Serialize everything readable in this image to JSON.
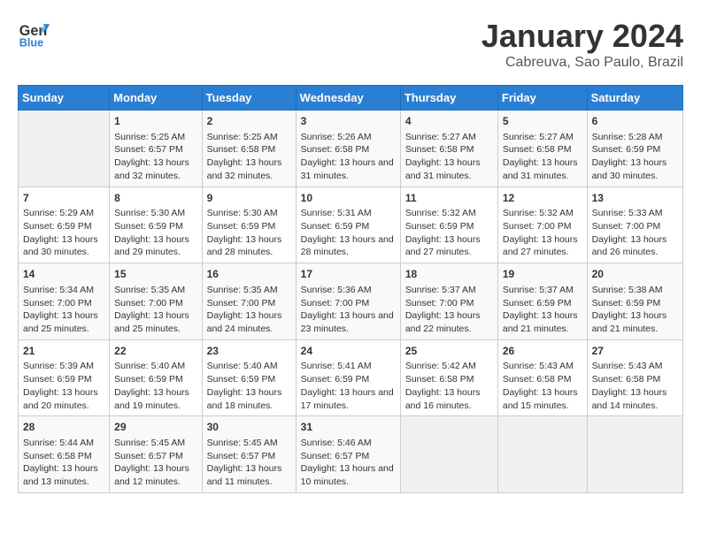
{
  "header": {
    "logo_line1": "General",
    "logo_line2": "Blue",
    "month_title": "January 2024",
    "location": "Cabreuva, Sao Paulo, Brazil"
  },
  "days_of_week": [
    "Sunday",
    "Monday",
    "Tuesday",
    "Wednesday",
    "Thursday",
    "Friday",
    "Saturday"
  ],
  "weeks": [
    [
      {
        "day": "",
        "empty": true
      },
      {
        "day": "1",
        "sunrise": "Sunrise: 5:25 AM",
        "sunset": "Sunset: 6:57 PM",
        "daylight": "Daylight: 13 hours and 32 minutes."
      },
      {
        "day": "2",
        "sunrise": "Sunrise: 5:25 AM",
        "sunset": "Sunset: 6:58 PM",
        "daylight": "Daylight: 13 hours and 32 minutes."
      },
      {
        "day": "3",
        "sunrise": "Sunrise: 5:26 AM",
        "sunset": "Sunset: 6:58 PM",
        "daylight": "Daylight: 13 hours and 31 minutes."
      },
      {
        "day": "4",
        "sunrise": "Sunrise: 5:27 AM",
        "sunset": "Sunset: 6:58 PM",
        "daylight": "Daylight: 13 hours and 31 minutes."
      },
      {
        "day": "5",
        "sunrise": "Sunrise: 5:27 AM",
        "sunset": "Sunset: 6:58 PM",
        "daylight": "Daylight: 13 hours and 31 minutes."
      },
      {
        "day": "6",
        "sunrise": "Sunrise: 5:28 AM",
        "sunset": "Sunset: 6:59 PM",
        "daylight": "Daylight: 13 hours and 30 minutes."
      }
    ],
    [
      {
        "day": "7",
        "sunrise": "Sunrise: 5:29 AM",
        "sunset": "Sunset: 6:59 PM",
        "daylight": "Daylight: 13 hours and 30 minutes."
      },
      {
        "day": "8",
        "sunrise": "Sunrise: 5:30 AM",
        "sunset": "Sunset: 6:59 PM",
        "daylight": "Daylight: 13 hours and 29 minutes."
      },
      {
        "day": "9",
        "sunrise": "Sunrise: 5:30 AM",
        "sunset": "Sunset: 6:59 PM",
        "daylight": "Daylight: 13 hours and 28 minutes."
      },
      {
        "day": "10",
        "sunrise": "Sunrise: 5:31 AM",
        "sunset": "Sunset: 6:59 PM",
        "daylight": "Daylight: 13 hours and 28 minutes."
      },
      {
        "day": "11",
        "sunrise": "Sunrise: 5:32 AM",
        "sunset": "Sunset: 6:59 PM",
        "daylight": "Daylight: 13 hours and 27 minutes."
      },
      {
        "day": "12",
        "sunrise": "Sunrise: 5:32 AM",
        "sunset": "Sunset: 7:00 PM",
        "daylight": "Daylight: 13 hours and 27 minutes."
      },
      {
        "day": "13",
        "sunrise": "Sunrise: 5:33 AM",
        "sunset": "Sunset: 7:00 PM",
        "daylight": "Daylight: 13 hours and 26 minutes."
      }
    ],
    [
      {
        "day": "14",
        "sunrise": "Sunrise: 5:34 AM",
        "sunset": "Sunset: 7:00 PM",
        "daylight": "Daylight: 13 hours and 25 minutes."
      },
      {
        "day": "15",
        "sunrise": "Sunrise: 5:35 AM",
        "sunset": "Sunset: 7:00 PM",
        "daylight": "Daylight: 13 hours and 25 minutes."
      },
      {
        "day": "16",
        "sunrise": "Sunrise: 5:35 AM",
        "sunset": "Sunset: 7:00 PM",
        "daylight": "Daylight: 13 hours and 24 minutes."
      },
      {
        "day": "17",
        "sunrise": "Sunrise: 5:36 AM",
        "sunset": "Sunset: 7:00 PM",
        "daylight": "Daylight: 13 hours and 23 minutes."
      },
      {
        "day": "18",
        "sunrise": "Sunrise: 5:37 AM",
        "sunset": "Sunset: 7:00 PM",
        "daylight": "Daylight: 13 hours and 22 minutes."
      },
      {
        "day": "19",
        "sunrise": "Sunrise: 5:37 AM",
        "sunset": "Sunset: 6:59 PM",
        "daylight": "Daylight: 13 hours and 21 minutes."
      },
      {
        "day": "20",
        "sunrise": "Sunrise: 5:38 AM",
        "sunset": "Sunset: 6:59 PM",
        "daylight": "Daylight: 13 hours and 21 minutes."
      }
    ],
    [
      {
        "day": "21",
        "sunrise": "Sunrise: 5:39 AM",
        "sunset": "Sunset: 6:59 PM",
        "daylight": "Daylight: 13 hours and 20 minutes."
      },
      {
        "day": "22",
        "sunrise": "Sunrise: 5:40 AM",
        "sunset": "Sunset: 6:59 PM",
        "daylight": "Daylight: 13 hours and 19 minutes."
      },
      {
        "day": "23",
        "sunrise": "Sunrise: 5:40 AM",
        "sunset": "Sunset: 6:59 PM",
        "daylight": "Daylight: 13 hours and 18 minutes."
      },
      {
        "day": "24",
        "sunrise": "Sunrise: 5:41 AM",
        "sunset": "Sunset: 6:59 PM",
        "daylight": "Daylight: 13 hours and 17 minutes."
      },
      {
        "day": "25",
        "sunrise": "Sunrise: 5:42 AM",
        "sunset": "Sunset: 6:58 PM",
        "daylight": "Daylight: 13 hours and 16 minutes."
      },
      {
        "day": "26",
        "sunrise": "Sunrise: 5:43 AM",
        "sunset": "Sunset: 6:58 PM",
        "daylight": "Daylight: 13 hours and 15 minutes."
      },
      {
        "day": "27",
        "sunrise": "Sunrise: 5:43 AM",
        "sunset": "Sunset: 6:58 PM",
        "daylight": "Daylight: 13 hours and 14 minutes."
      }
    ],
    [
      {
        "day": "28",
        "sunrise": "Sunrise: 5:44 AM",
        "sunset": "Sunset: 6:58 PM",
        "daylight": "Daylight: 13 hours and 13 minutes."
      },
      {
        "day": "29",
        "sunrise": "Sunrise: 5:45 AM",
        "sunset": "Sunset: 6:57 PM",
        "daylight": "Daylight: 13 hours and 12 minutes."
      },
      {
        "day": "30",
        "sunrise": "Sunrise: 5:45 AM",
        "sunset": "Sunset: 6:57 PM",
        "daylight": "Daylight: 13 hours and 11 minutes."
      },
      {
        "day": "31",
        "sunrise": "Sunrise: 5:46 AM",
        "sunset": "Sunset: 6:57 PM",
        "daylight": "Daylight: 13 hours and 10 minutes."
      },
      {
        "day": "",
        "empty": true
      },
      {
        "day": "",
        "empty": true
      },
      {
        "day": "",
        "empty": true
      }
    ]
  ]
}
